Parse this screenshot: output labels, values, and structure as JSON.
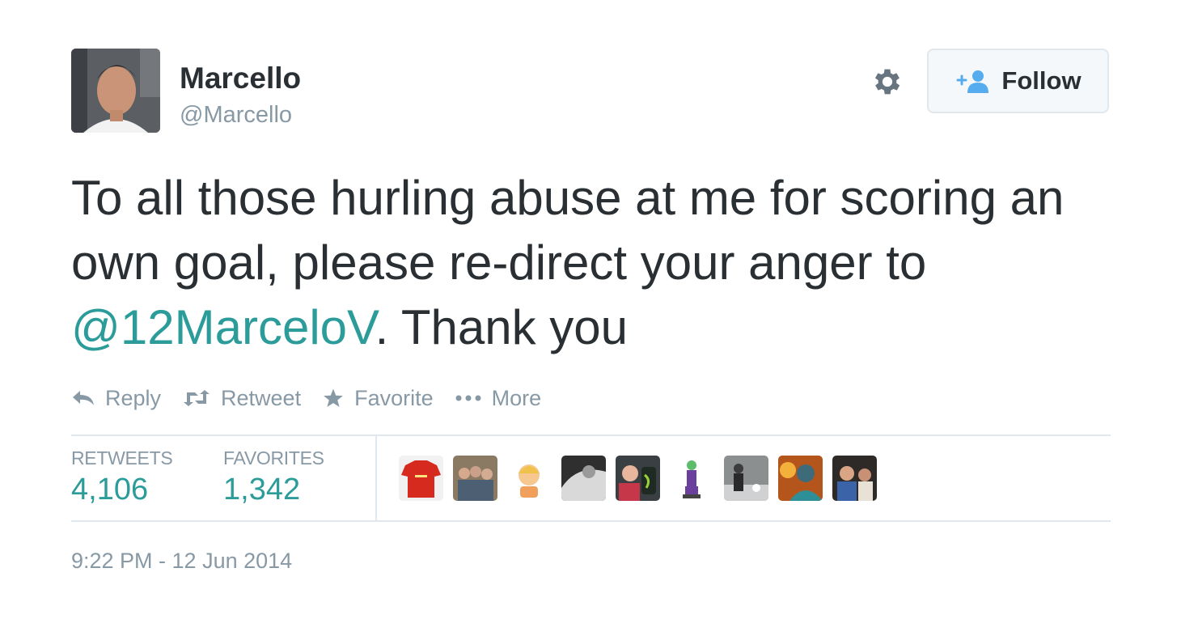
{
  "user": {
    "name": "Marcello",
    "handle": "@Marcello"
  },
  "follow_button": {
    "label": "Follow"
  },
  "tweet": {
    "text_before": "To all those hurling abuse at me for scoring an own goal, please re-direct your anger to ",
    "mention": "@12MarceloV",
    "text_after": ". Thank you"
  },
  "actions": [
    {
      "icon": "reply-icon",
      "label": "Reply"
    },
    {
      "icon": "retweet-icon",
      "label": "Retweet"
    },
    {
      "icon": "star-icon",
      "label": "Favorite"
    },
    {
      "icon": "more-dots-icon",
      "label": "More"
    }
  ],
  "stats": {
    "retweets_label": "RETWEETS",
    "retweets_value": "4,106",
    "favorites_label": "FAVORITES",
    "favorites_value": "1,342"
  },
  "timestamp": "9:22 PM - 12 Jun 2014",
  "colors": {
    "link": "#2b9c9a",
    "muted": "#8899a6",
    "text": "#292f33",
    "border": "#e1e8ed"
  }
}
